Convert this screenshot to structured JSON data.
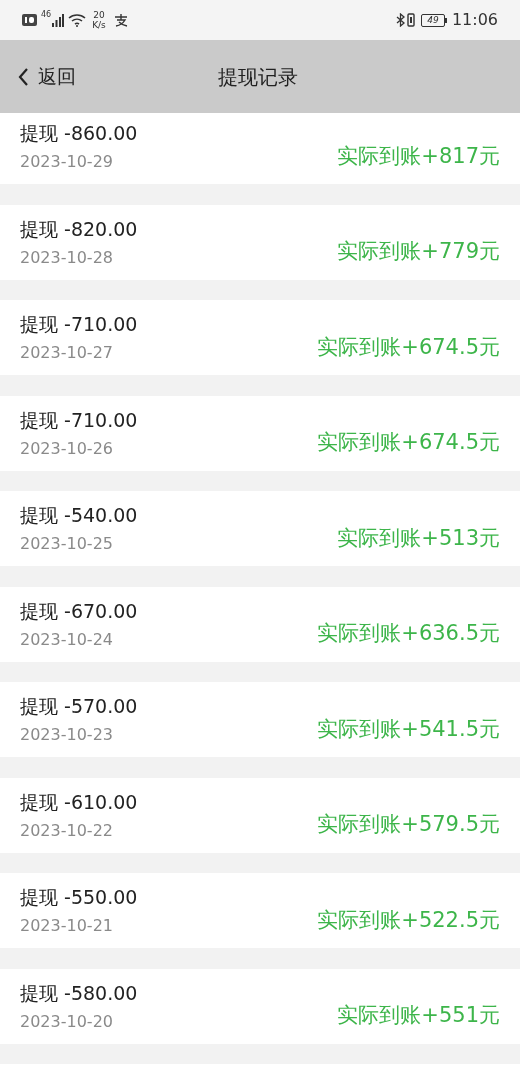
{
  "status_bar": {
    "network": "46",
    "speed_value": "20",
    "speed_unit": "K/s",
    "battery": "49",
    "time": "11:06"
  },
  "header": {
    "back_label": "返回",
    "title": "提现记录"
  },
  "records": [
    {
      "title": "提现 -860.00",
      "date": "2023-10-29",
      "received": "实际到账+817元"
    },
    {
      "title": "提现 -820.00",
      "date": "2023-10-28",
      "received": "实际到账+779元"
    },
    {
      "title": "提现 -710.00",
      "date": "2023-10-27",
      "received": "实际到账+674.5元"
    },
    {
      "title": "提现 -710.00",
      "date": "2023-10-26",
      "received": "实际到账+674.5元"
    },
    {
      "title": "提现 -540.00",
      "date": "2023-10-25",
      "received": "实际到账+513元"
    },
    {
      "title": "提现 -670.00",
      "date": "2023-10-24",
      "received": "实际到账+636.5元"
    },
    {
      "title": "提现 -570.00",
      "date": "2023-10-23",
      "received": "实际到账+541.5元"
    },
    {
      "title": "提现 -610.00",
      "date": "2023-10-22",
      "received": "实际到账+579.5元"
    },
    {
      "title": "提现 -550.00",
      "date": "2023-10-21",
      "received": "实际到账+522.5元"
    },
    {
      "title": "提现 -580.00",
      "date": "2023-10-20",
      "received": "实际到账+551元"
    }
  ]
}
